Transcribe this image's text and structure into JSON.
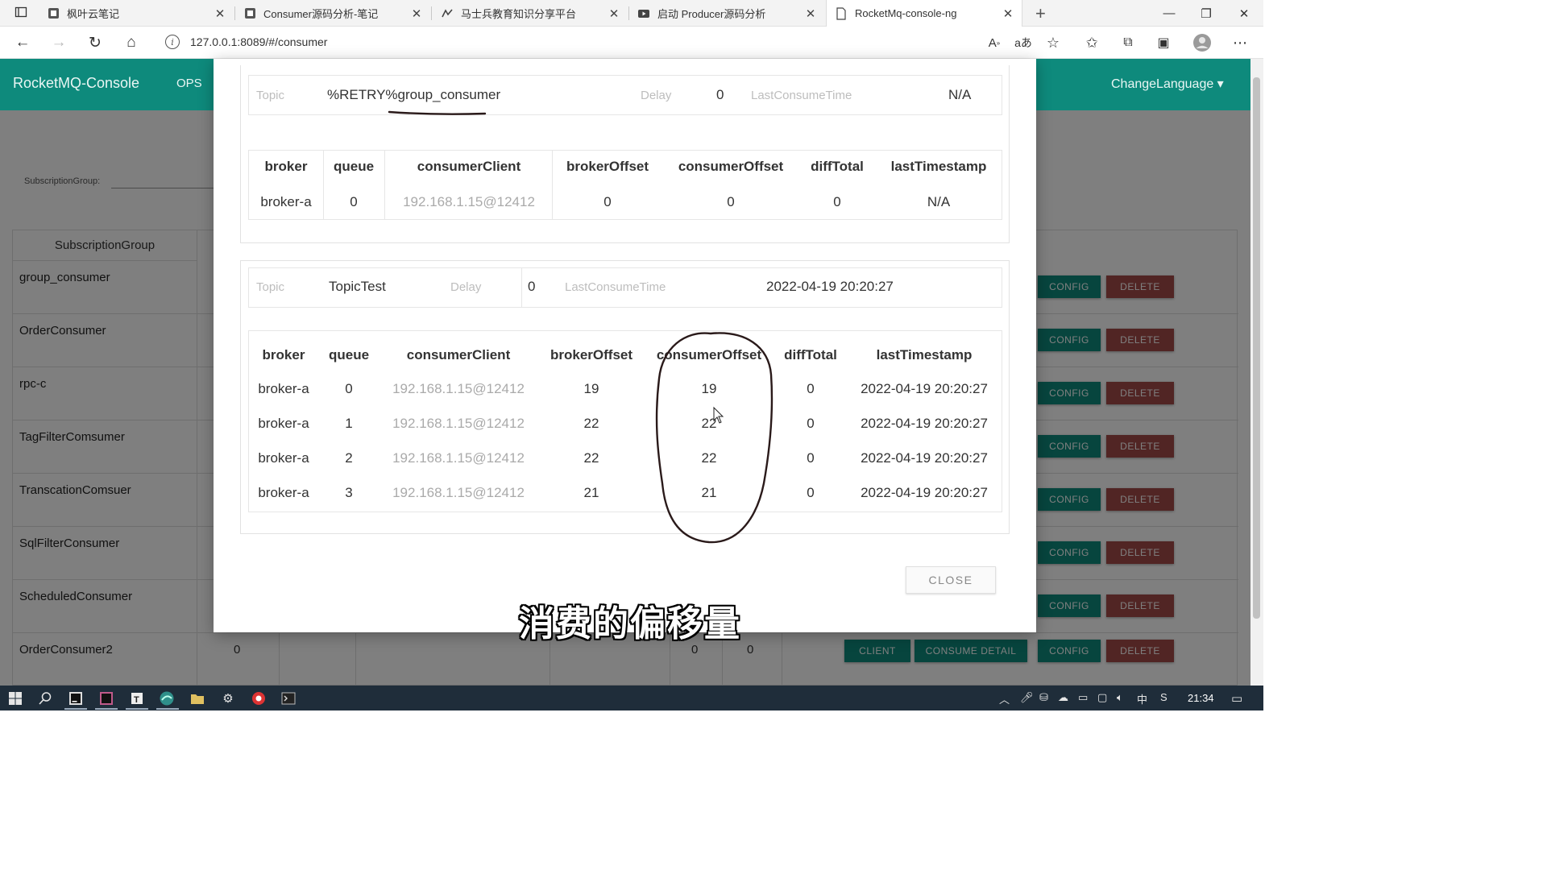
{
  "browser": {
    "tabs": [
      {
        "title": "枫叶云笔记",
        "icon": "note-app-icon"
      },
      {
        "title": "Consumer源码分析-笔记",
        "icon": "note-app-icon"
      },
      {
        "title": "马士兵教育知识分享平台",
        "icon": "share-platform-icon"
      },
      {
        "title": "启动 Producer源码分析",
        "icon": "video-icon"
      },
      {
        "title": "RocketMq-console-ng",
        "icon": "page-icon",
        "active": true
      }
    ],
    "url": "127.0.0.1:8089/#/consumer",
    "new_tab_label": "+"
  },
  "app": {
    "brand": "RocketMQ-Console",
    "nav_ops": "OPS",
    "change_language": "ChangeLanguage ▾",
    "subscription_group_label": "SubscriptionGroup:",
    "table_header": "SubscriptionGroup",
    "groups": [
      "group_consumer",
      "OrderConsumer",
      "rpc-c",
      "TagFilterComsumer",
      "TranscationComsuer",
      "SqlFilterConsumer",
      "ScheduledConsumer",
      "OrderConsumer2"
    ],
    "btn_client": "CLIENT",
    "btn_consume_detail": "CONSUME DETAIL",
    "btn_config": "CONFIG",
    "btn_delete": "DELETE",
    "last_row_values": [
      "0",
      "0",
      "0"
    ]
  },
  "modal": {
    "topic_label": "Topic",
    "delay_label": "Delay",
    "last_consume_time_label": "LastConsumeTime",
    "columns": [
      "broker",
      "queue",
      "consumerClient",
      "brokerOffset",
      "consumerOffset",
      "diffTotal",
      "lastTimestamp"
    ],
    "sections": [
      {
        "topic": "%RETRY%group_consumer",
        "delay": "0",
        "last_consume_time": "N/A",
        "rows": [
          {
            "broker": "broker-a",
            "queue": "0",
            "consumerClient": "192.168.1.15@12412",
            "brokerOffset": "0",
            "consumerOffset": "0",
            "diffTotal": "0",
            "lastTimestamp": "N/A"
          }
        ]
      },
      {
        "topic": "TopicTest",
        "delay": "0",
        "last_consume_time": "2022-04-19 20:20:27",
        "rows": [
          {
            "broker": "broker-a",
            "queue": "0",
            "consumerClient": "192.168.1.15@12412",
            "brokerOffset": "19",
            "consumerOffset": "19",
            "diffTotal": "0",
            "lastTimestamp": "2022-04-19 20:20:27"
          },
          {
            "broker": "broker-a",
            "queue": "1",
            "consumerClient": "192.168.1.15@12412",
            "brokerOffset": "22",
            "consumerOffset": "22",
            "diffTotal": "0",
            "lastTimestamp": "2022-04-19 20:20:27"
          },
          {
            "broker": "broker-a",
            "queue": "2",
            "consumerClient": "192.168.1.15@12412",
            "brokerOffset": "22",
            "consumerOffset": "22",
            "diffTotal": "0",
            "lastTimestamp": "2022-04-19 20:20:27"
          },
          {
            "broker": "broker-a",
            "queue": "3",
            "consumerClient": "192.168.1.15@12412",
            "brokerOffset": "21",
            "consumerOffset": "21",
            "diffTotal": "0",
            "lastTimestamp": "2022-04-19 20:20:27"
          }
        ]
      }
    ],
    "close_label": "CLOSE"
  },
  "subtitle": "消费的偏移量",
  "taskbar": {
    "ime": "中",
    "time": "21:34"
  },
  "colors": {
    "brand_teal": "#0e8a7c",
    "delete_red": "#a34b48",
    "annotation": "#2a1a1a"
  }
}
